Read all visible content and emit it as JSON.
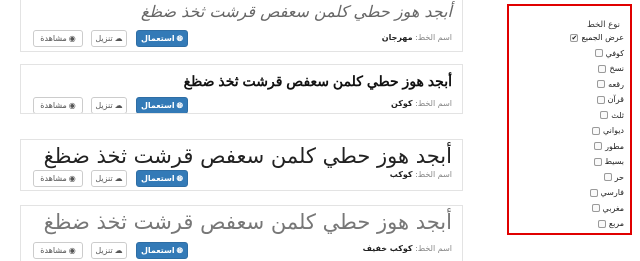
{
  "fonts": [
    {
      "sample": "أبجد هوز حطي كلمن سعفص قرشت ثخذ ضظغ",
      "type_label": "اسم الخط:",
      "type_value": "مهرجان",
      "use_label": "استعمال",
      "download_label": "تنزيل",
      "view_label": "مشاهدة"
    },
    {
      "sample": "أبجد هوز حطي كلمن سعفص قرشت ثخذ ضظغ",
      "type_label": "اسم الخط:",
      "type_value": "كوكن",
      "use_label": "استعمال",
      "download_label": "تنزيل",
      "view_label": "مشاهدة"
    },
    {
      "sample": "أبجد هوز حطي كلمن سعفص قرشت ثخذ ضظغ",
      "type_label": "اسم الخط:",
      "type_value": "كوكب",
      "use_label": "استعمال",
      "download_label": "تنزيل",
      "view_label": "مشاهدة"
    },
    {
      "sample": "أبجد هوز حطي كلمن سعفص قرشت ثخذ ضظغ",
      "type_label": "اسم الخط:",
      "type_value": "كوكب خفيف",
      "use_label": "استعمال",
      "download_label": "تنزيل",
      "view_label": "مشاهدة"
    }
  ],
  "filter": {
    "title": "نوع الخط",
    "options": [
      {
        "label": "عرض الجميع",
        "checked": true
      },
      {
        "label": "كوفي",
        "checked": false
      },
      {
        "label": "نسخ",
        "checked": false
      },
      {
        "label": "رقعه",
        "checked": false
      },
      {
        "label": "قرآن",
        "checked": false
      },
      {
        "label": "ثلث",
        "checked": false
      },
      {
        "label": "ديواني",
        "checked": false
      },
      {
        "label": "مطور",
        "checked": false
      },
      {
        "label": "بسيط",
        "checked": false
      },
      {
        "label": "حر",
        "checked": false
      },
      {
        "label": "فارسي",
        "checked": false
      },
      {
        "label": "مغربي",
        "checked": false
      },
      {
        "label": "مربع",
        "checked": false
      }
    ]
  },
  "colors": {
    "primary_button": "#337ab7",
    "highlight_border": "#e00000"
  },
  "icons": {
    "use": "globe-icon",
    "download": "cloud-download-icon",
    "view": "eye-icon",
    "check": "checkmark-icon"
  }
}
